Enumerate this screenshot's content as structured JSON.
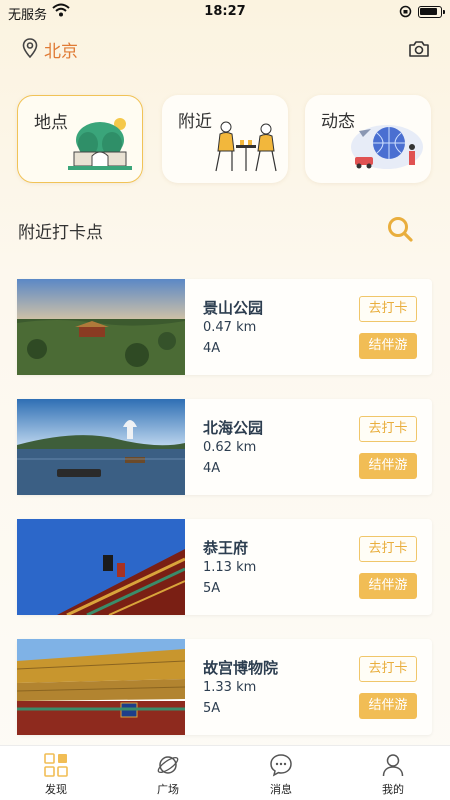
{
  "status_bar": {
    "carrier": "无服务",
    "time": "18:27"
  },
  "header": {
    "city": "北京"
  },
  "categories": [
    {
      "label": "地点",
      "active": true
    },
    {
      "label": "附近",
      "active": false
    },
    {
      "label": "动态",
      "active": false
    }
  ],
  "section": {
    "title": "附近打卡点"
  },
  "places": [
    {
      "name": "景山公园",
      "distance": "0.47 km",
      "level": "4A",
      "checkin_label": "去打卡",
      "buddy_label": "结伴游"
    },
    {
      "name": "北海公园",
      "distance": "0.62 km",
      "level": "4A",
      "checkin_label": "去打卡",
      "buddy_label": "结伴游"
    },
    {
      "name": "恭王府",
      "distance": "1.13 km",
      "level": "5A",
      "checkin_label": "去打卡",
      "buddy_label": "结伴游"
    },
    {
      "name": "故宫博物院",
      "distance": "1.33 km",
      "level": "5A",
      "checkin_label": "去打卡",
      "buddy_label": "结伴游"
    }
  ],
  "tabbar": [
    {
      "label": "发现",
      "icon": "discover-icon",
      "active": true
    },
    {
      "label": "广场",
      "icon": "planet-icon",
      "active": false
    },
    {
      "label": "消息",
      "icon": "chat-bubble-icon",
      "active": false
    },
    {
      "label": "我的",
      "icon": "person-icon",
      "active": false
    }
  ],
  "colors": {
    "accent": "#f1bd55",
    "city": "#e07b35",
    "text_dark": "#2d3e50"
  }
}
